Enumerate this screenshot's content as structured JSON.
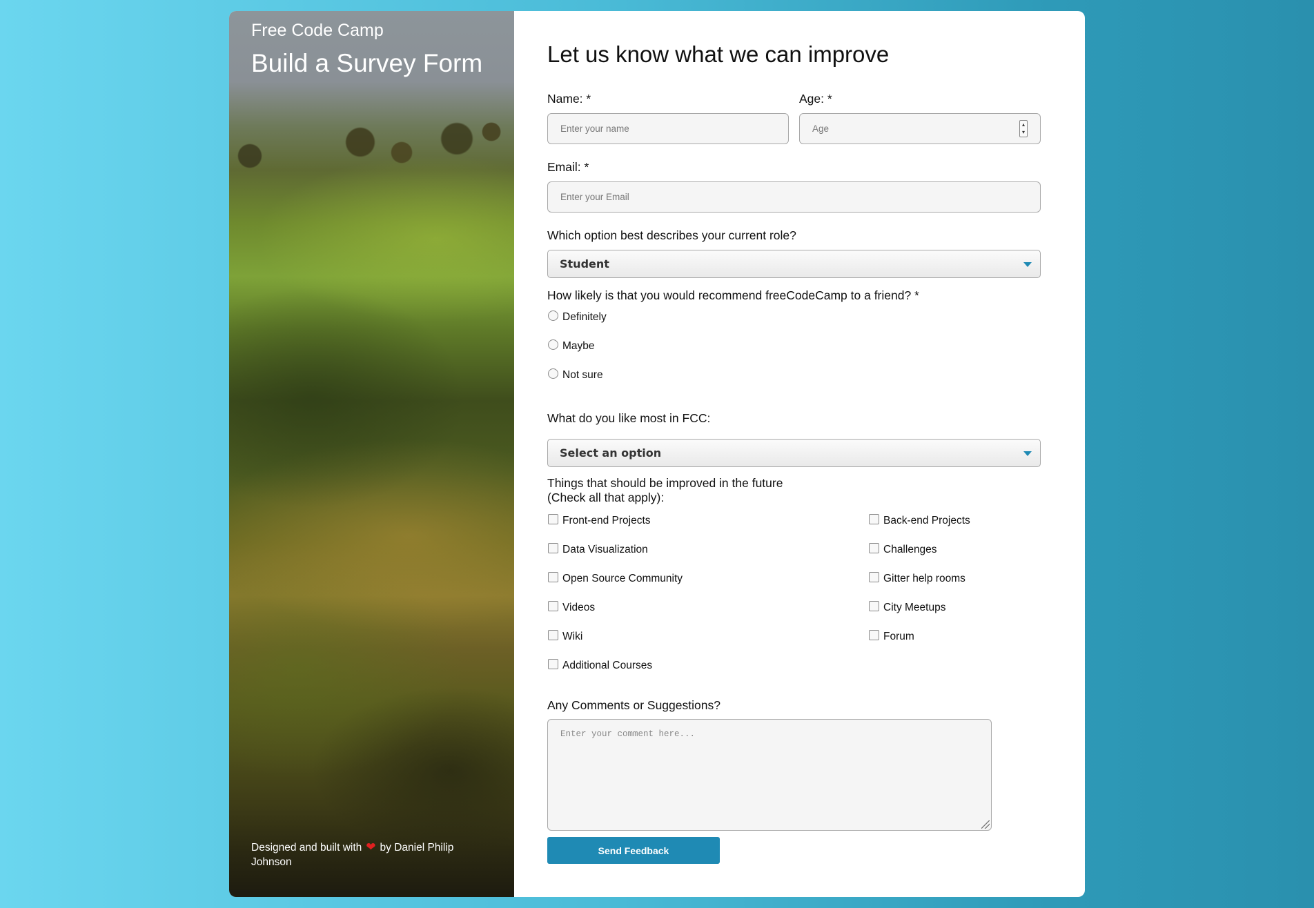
{
  "sidebar": {
    "brand": "Free Code Camp",
    "title": "Build a Survey Form",
    "footer_prefix": "Designed and built with",
    "footer_heart": "❤",
    "footer_suffix": "by Daniel Philip Johnson"
  },
  "form": {
    "heading": "Let us know what we can improve",
    "name_label": "Name: *",
    "name_placeholder": "Enter your name",
    "age_label": "Age: *",
    "age_placeholder": "Age",
    "email_label": "Email: *",
    "email_placeholder": "Enter your Email",
    "role_label": "Which option best describes your current role?",
    "role_value": "Student",
    "recommend_label": "How likely is that you would recommend freeCodeCamp to a friend? *",
    "recommend_options": [
      "Definitely",
      "Maybe",
      "Not sure"
    ],
    "like_label": "What do you like most in FCC:",
    "like_value": "Select an option",
    "improve_label_line1": "Things that should be improved in the future",
    "improve_label_line2": "(Check all that apply):",
    "improve_options_left": [
      "Front-end Projects",
      "Data Visualization",
      "Open Source Community",
      "Videos",
      "Wiki",
      "Additional Courses"
    ],
    "improve_options_right": [
      "Back-end Projects",
      "Challenges",
      "Gitter help rooms",
      "City Meetups",
      "Forum"
    ],
    "comments_label": "Any Comments or Suggestions?",
    "comments_placeholder": "Enter your comment here...",
    "submit_label": "Send Feedback"
  },
  "colors": {
    "accent": "#1f8ab4",
    "heart": "#e02020",
    "background_left": "#6bd6ef",
    "background_right": "#2a90ae"
  }
}
